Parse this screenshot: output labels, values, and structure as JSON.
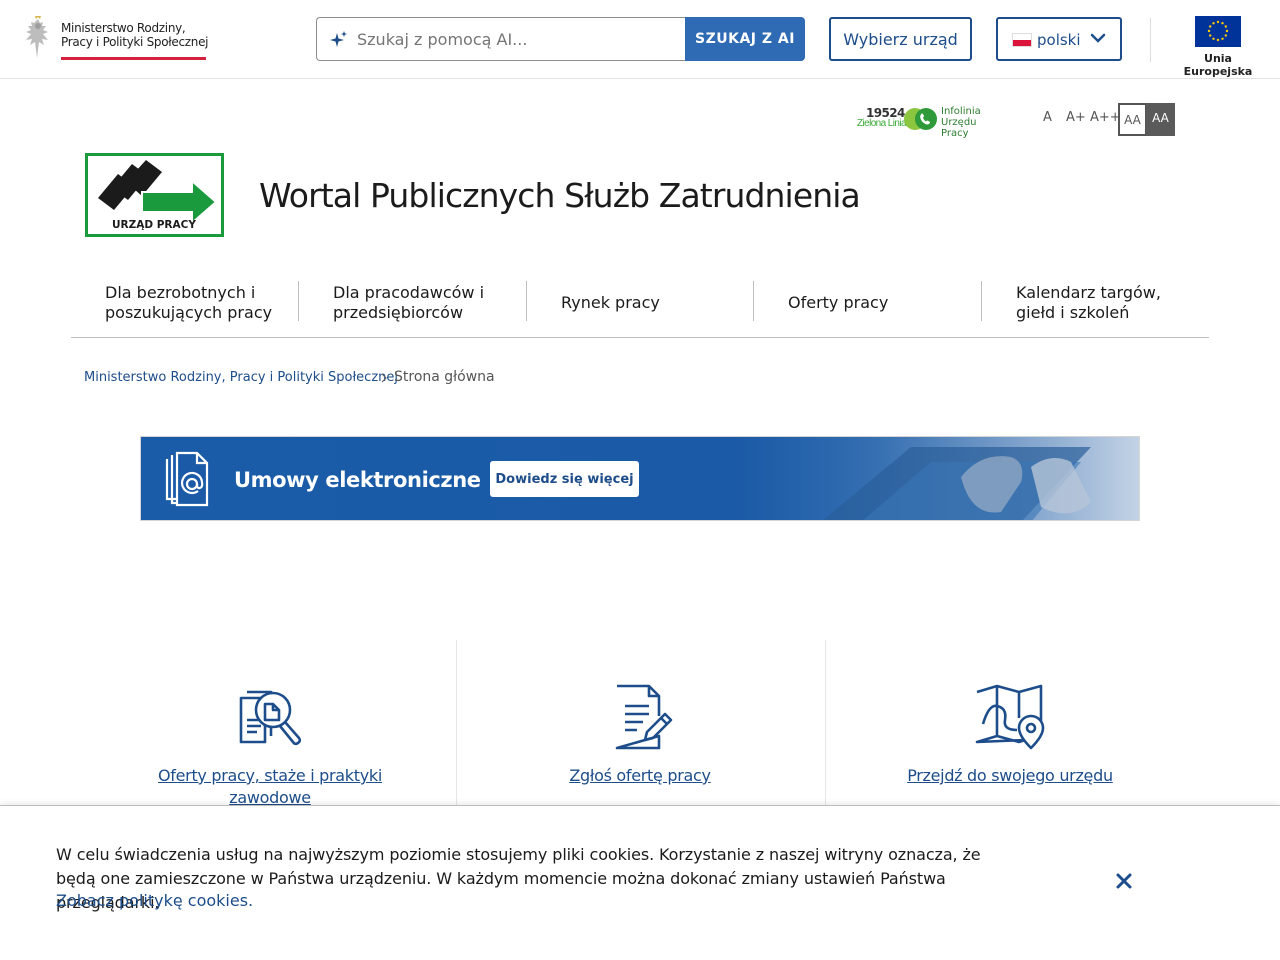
{
  "header": {
    "ministry_line1": "Ministerstwo Rodziny,",
    "ministry_line2": "Pracy i Polityki Społecznej",
    "search_placeholder": "Szukaj z pomocą AI...",
    "search_button": "SZUKAJ Z AI",
    "office_button": "Wybierz urząd",
    "language": "polski",
    "eu_label": "Unia Europejska"
  },
  "infoline": {
    "number": "19524",
    "brand": "Zielona Linia",
    "line1": "Infolinia",
    "line2": "Urzędu Pracy"
  },
  "font_size": {
    "a1": "A",
    "a2": "A+",
    "a3": "A++",
    "contrast1": "AA",
    "contrast2": "AA"
  },
  "brand": {
    "logo_text": "URZĄD PRACY",
    "title": "Wortal Publicznych Służb Zatrudnienia"
  },
  "nav": [
    {
      "line1": "Dla bezrobotnych i",
      "line2": "poszukujących pracy"
    },
    {
      "line1": "Dla pracodawców i",
      "line2": "przedsiębiorców"
    },
    {
      "line1": "Rynek pracy",
      "line2": ""
    },
    {
      "line1": "Oferty pracy",
      "line2": ""
    },
    {
      "line1": "Kalendarz targów,",
      "line2": "giełd i szkoleń"
    }
  ],
  "breadcrumb": {
    "parent": "Ministerstwo Rodziny, Pracy i Polityki Społecznej",
    "current": "Strona główna"
  },
  "banner": {
    "title": "Umowy elektroniczne",
    "button": "Dowiedz się więcej"
  },
  "tiles": [
    {
      "label": "Oferty pracy, staże i praktyki zawodowe",
      "icon": "job-search-icon"
    },
    {
      "label": "Zgłoś ofertę pracy",
      "icon": "document-edit-icon"
    },
    {
      "label": "Przejdź do swojego urzędu",
      "icon": "map-pin-icon"
    }
  ],
  "cookie": {
    "text": "W celu świadczenia usług na najwyższym poziomie stosujemy pliki cookies. Korzystanie z naszej witryny oznacza, że będą one zamieszczone w Państwa urządzeniu. W każdym momencie można dokonać zmiany ustawień Państwa przeglądarki.",
    "link": "Zobacz politykę cookies."
  },
  "colors": {
    "accent": "#2f6bb5",
    "link": "#1d4d8a",
    "green": "#1a9a3c",
    "eu_blue": "#003399"
  }
}
